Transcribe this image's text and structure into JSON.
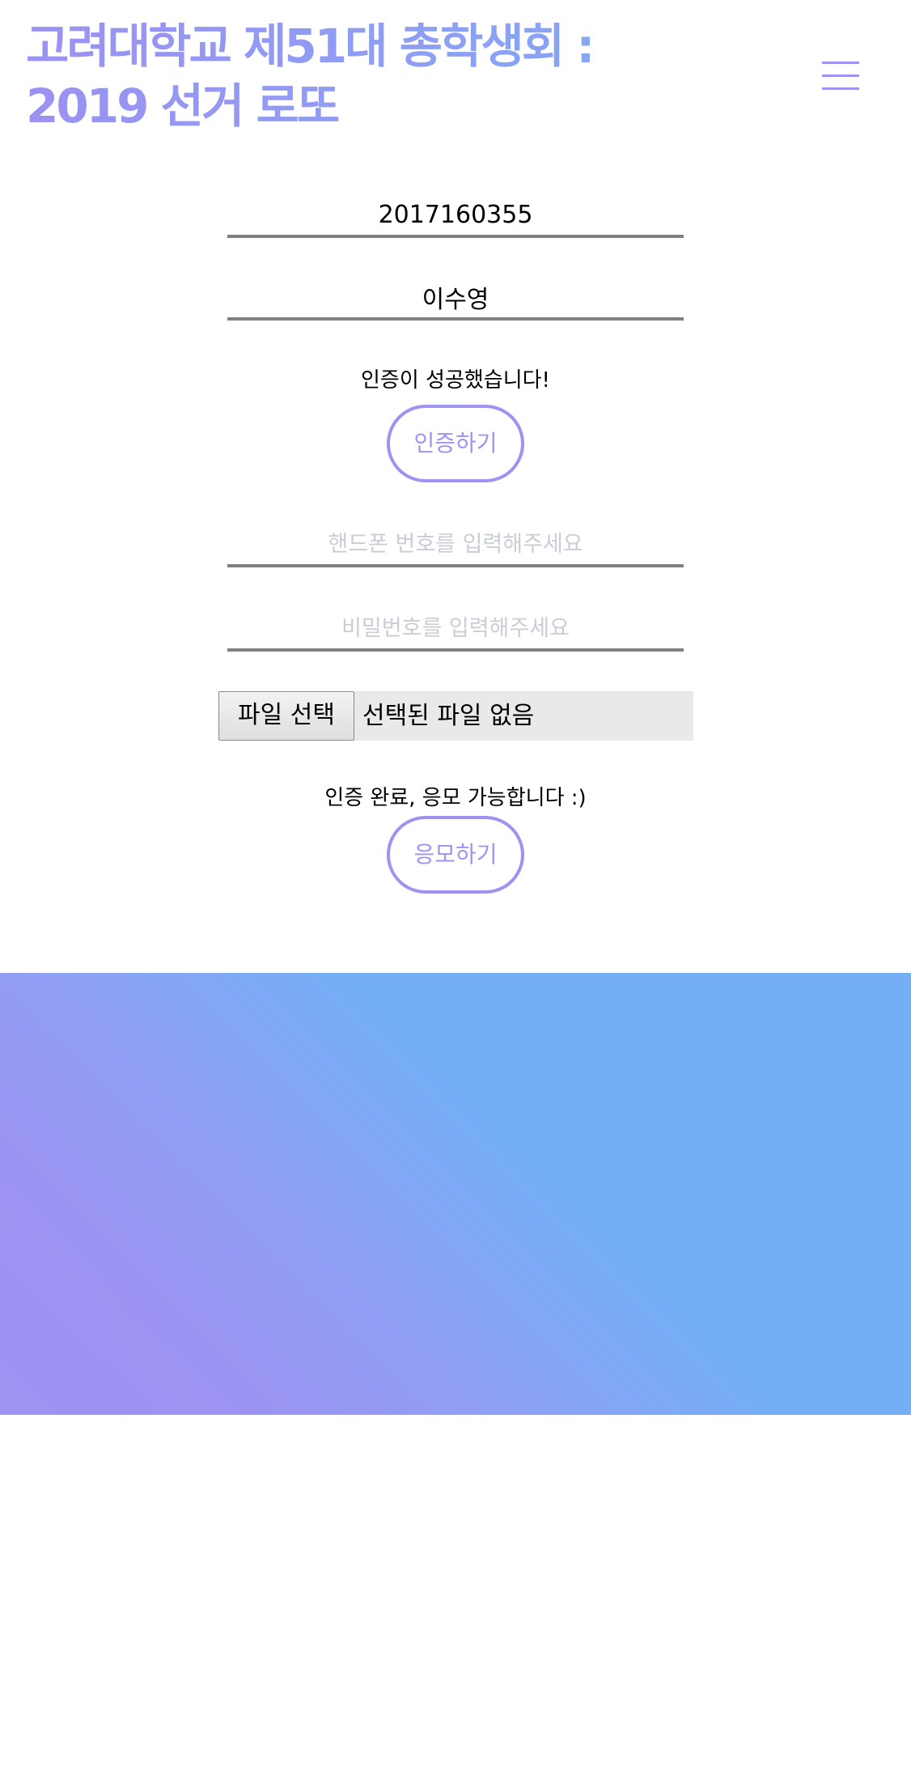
{
  "header": {
    "title_line1": "고려대학교 제51대 총학생회 :",
    "title_line2": "2019 선거 로또",
    "menu_icon": "hamburger-menu-icon"
  },
  "form": {
    "student_id_value": "2017160355",
    "name_value": "이수영",
    "auth_status": "인증이 성공했습니다!",
    "auth_button_label": "인증하기",
    "phone_placeholder": "핸드폰 번호를 입력해주세요",
    "password_placeholder": "비밀번호를 입력해주세요",
    "file_button_label": "파일 선택",
    "file_status": "선택된 파일 없음",
    "apply_status": "인증 완료, 응모 가능합니다 :)",
    "apply_button_label": "응모하기"
  },
  "colors": {
    "accent": "#9d93f2",
    "banner_blue": "#74aff6",
    "banner_purple": "#9e92f3",
    "placeholder": "#c9cdd6"
  }
}
